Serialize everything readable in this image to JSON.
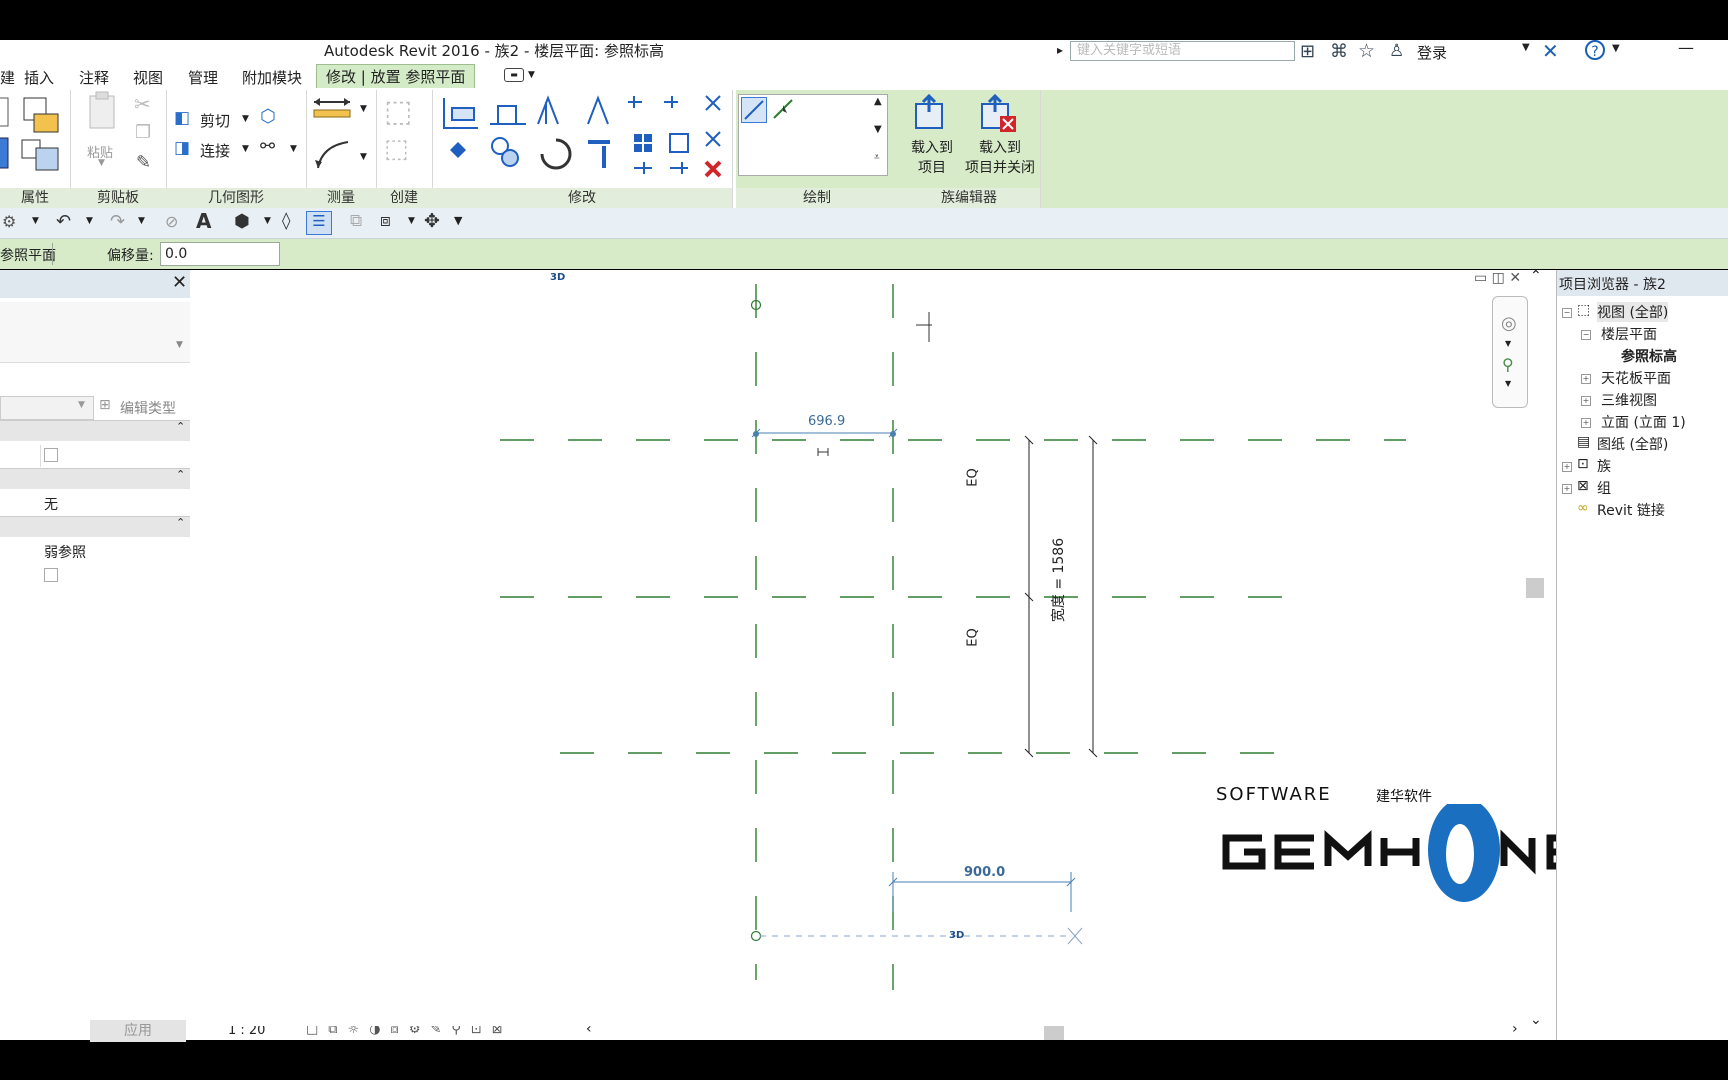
{
  "app": {
    "title": "Autodesk Revit 2016 -     族2 - 楼层平面: 参照标高",
    "search_placeholder": "键入关键字或短语",
    "login_label": "登录"
  },
  "menu_tabs": [
    "插入",
    "注释",
    "视图",
    "管理",
    "附加模块",
    "修改 | 放置 参照平面"
  ],
  "ribbon": {
    "panels": {
      "properties": "属性",
      "clipboard": "剪贴板",
      "geometry": "几何图形",
      "measure": "测量",
      "create": "创建",
      "modify": "修改",
      "draw": "绘制",
      "family_editor": "族编辑器"
    },
    "paste_label": "粘贴",
    "cut_label": "剪切",
    "join_label": "连接",
    "load_into_project_l1": "载入到",
    "load_into_project_l2": "项目",
    "load_close_l1": "载入到",
    "load_close_l2": "项目并关闭"
  },
  "options_bar": {
    "left_label": "参照平面",
    "offset_label": "偏移量:",
    "offset_value": "0.0"
  },
  "properties_panel": {
    "edit_type_label": "编辑类型",
    "value_none": "无",
    "value_weak_ref": "弱参照",
    "apply_label": "应用"
  },
  "canvas": {
    "dim_top": "696.9",
    "dim_bottom": "900.0",
    "eq_label": "EQ",
    "width_label": "宽度 = 1586",
    "tag_3d": "3D"
  },
  "project_browser": {
    "title": "项目浏览器 - 族2",
    "items": [
      {
        "label": "视图 (全部)"
      },
      {
        "label": "楼层平面"
      },
      {
        "label": "参照标高"
      },
      {
        "label": "天花板平面"
      },
      {
        "label": "三维视图"
      },
      {
        "label": "立面 (立面 1)"
      },
      {
        "label": "图纸 (全部)"
      },
      {
        "label": "族"
      },
      {
        "label": "组"
      },
      {
        "label": "Revit 链接"
      }
    ]
  },
  "status_bar": {
    "scale": "1 : 20"
  },
  "watermark": {
    "line1": "SOFTWARE",
    "line1_cn": "建华软件",
    "brand": "GEMHONE"
  },
  "colors": {
    "ribbon_green": "#d7ebc9",
    "ref_plane": "#2d7d32",
    "dim_blue": "#4a7fb0",
    "logo_blue": "#1a6fc0"
  }
}
